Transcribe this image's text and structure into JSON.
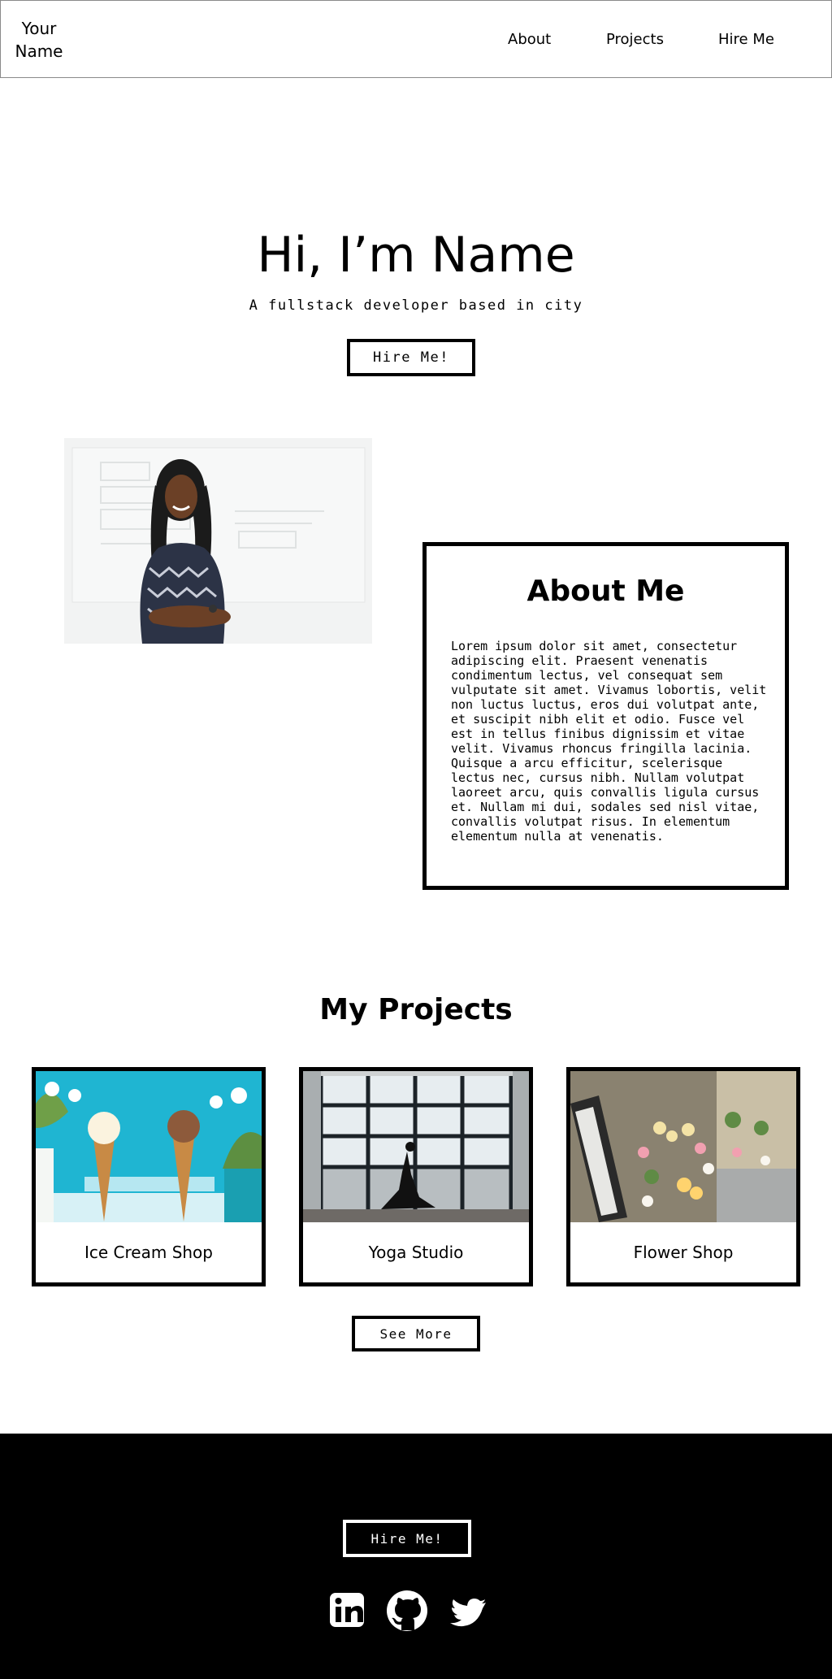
{
  "header": {
    "brand": "Your Name",
    "nav": {
      "about": "About",
      "projects": "Projects",
      "hire": "Hire Me"
    }
  },
  "hero": {
    "title": "Hi, I’m Name",
    "subtitle": "A fullstack developer based in city",
    "button": "Hire Me!"
  },
  "about": {
    "title": "About Me",
    "text": "Lorem ipsum dolor sit amet, consectetur adipiscing elit. Praesent venenatis condimentum lectus, vel consequat sem vulputate sit amet. Vivamus lobortis, velit non luctus luctus, eros dui volutpat ante, et suscipit nibh elit et odio. Fusce vel est in tellus finibus dignissim et vitae velit. Vivamus rhoncus fringilla lacinia. Quisque a arcu efficitur, scelerisque lectus nec, cursus nibh. Nullam volutpat laoreet arcu, quis convallis ligula cursus et. Nullam mi dui, sodales sed nisl vitae, convallis volutpat risus. In elementum elementum nulla at venenatis."
  },
  "projects": {
    "title": "My Projects",
    "items": [
      {
        "label": "Ice Cream Shop"
      },
      {
        "label": "Yoga Studio"
      },
      {
        "label": "Flower Shop"
      }
    ],
    "see_more": "See More"
  },
  "footer": {
    "button": "Hire Me!",
    "icons": [
      "linkedin-icon",
      "github-icon",
      "twitter-icon"
    ]
  },
  "colors": {
    "background": "#ffffff",
    "text": "#000000",
    "footer": "#000000",
    "accent": "#1fb5d2"
  }
}
